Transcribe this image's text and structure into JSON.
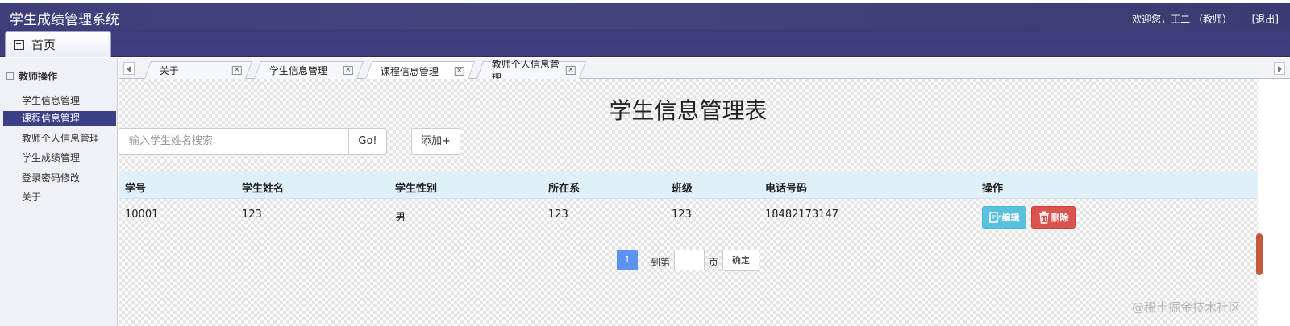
{
  "app": {
    "title": "学生成绩管理系统",
    "welcome": "欢迎您，王二 （教师）",
    "logout": "[退出]",
    "home_tab": "首页"
  },
  "sidebar": {
    "group": "教师操作",
    "items": [
      {
        "label": "学生信息管理"
      },
      {
        "label": "课程信息管理"
      },
      {
        "label": "教师个人信息管理"
      },
      {
        "label": "学生成绩管理"
      },
      {
        "label": "登录密码修改"
      },
      {
        "label": "关于"
      }
    ],
    "active_item": "课程信息管理"
  },
  "tabs": [
    {
      "label": "关于"
    },
    {
      "label": "学生信息管理"
    },
    {
      "label": "课程信息管理"
    },
    {
      "label": "教师个人信息管理"
    }
  ],
  "main": {
    "page_title": "学生信息管理表",
    "search_placeholder": "输入学生姓名搜索",
    "go_label": "Go!",
    "add_label": "添加+",
    "columns": [
      "学号",
      "学生姓名",
      "学生性别",
      "所在系",
      "班级",
      "电话号码",
      "操作"
    ],
    "rows": [
      [
        "10001",
        "123",
        "男",
        "123",
        "123",
        "18482173147"
      ]
    ],
    "edit_label": "编辑",
    "delete_label": "删除",
    "pager": {
      "current_page": "1",
      "goto_label": "到第",
      "page_unit": "页",
      "confirm_label": "确定"
    }
  },
  "watermark": "@稀土掘金技术社区",
  "colors": {
    "header_bg": "#3f3d7a",
    "sidebar_active": "#3b3f86",
    "table_head_bg": "#dff0f8",
    "edit_btn": "#5bc0de",
    "delete_btn": "#d9534f",
    "page_active": "#5b93f2"
  }
}
